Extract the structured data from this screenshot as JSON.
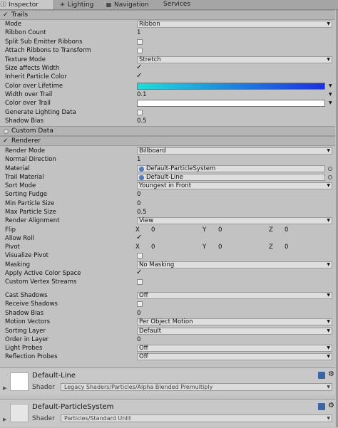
{
  "tabs": [
    {
      "icon": "info-icon",
      "glyph": "ⓘ",
      "label": "Inspector"
    },
    {
      "icon": "lighting-icon",
      "glyph": "☀",
      "label": "Lighting"
    },
    {
      "icon": "navigation-icon",
      "glyph": "▦",
      "label": "Navigation"
    },
    {
      "icon": "",
      "glyph": "",
      "label": "Services"
    }
  ],
  "trails": {
    "header": "Trails",
    "mode": {
      "label": "Mode",
      "value": "Ribbon"
    },
    "ribbon_count": {
      "label": "Ribbon Count",
      "value": "1"
    },
    "split_sub": {
      "label": "Split Sub Emitter Ribbons",
      "checked": false
    },
    "attach_ribbons": {
      "label": "Attach Ribbons to Transform",
      "checked": false
    },
    "texture_mode": {
      "label": "Texture Mode",
      "value": "Stretch"
    },
    "size_affects_width": {
      "label": "Size affects Width",
      "checked": true
    },
    "inherit_color": {
      "label": "Inherit Particle Color",
      "checked": true
    },
    "color_over_lifetime": {
      "label": "Color over Lifetime",
      "gradient_from": "#19e0dc",
      "gradient_to": "#1d2fe6"
    },
    "width_over_trail": {
      "label": "Width over Trail",
      "value": "0.1"
    },
    "color_over_trail": {
      "label": "Color over Trail",
      "color": "#ffffff"
    },
    "generate_lighting": {
      "label": "Generate Lighting Data",
      "checked": false
    },
    "shadow_bias": {
      "label": "Shadow Bias",
      "value": "0.5"
    }
  },
  "custom_data": {
    "header": "Custom Data"
  },
  "renderer": {
    "header": "Renderer",
    "render_mode": {
      "label": "Render Mode",
      "value": "Billboard"
    },
    "normal_direction": {
      "label": "Normal Direction",
      "value": "1"
    },
    "material": {
      "label": "Material",
      "value": "Default-ParticleSystem"
    },
    "trail_material": {
      "label": "Trail Material",
      "value": "Default-Line"
    },
    "sort_mode": {
      "label": "Sort Mode",
      "value": "Youngest in Front"
    },
    "sorting_fudge": {
      "label": "Sorting Fudge",
      "value": "0"
    },
    "min_particle_size": {
      "label": "Min Particle Size",
      "value": "0"
    },
    "max_particle_size": {
      "label": "Max Particle Size",
      "value": "0.5"
    },
    "render_alignment": {
      "label": "Render Alignment",
      "value": "View"
    },
    "flip": {
      "label": "Flip",
      "x_label": "X",
      "x": "0",
      "y_label": "Y",
      "y": "0",
      "z_label": "Z",
      "z": "0"
    },
    "allow_roll": {
      "label": "Allow Roll",
      "checked": true
    },
    "pivot": {
      "label": "Pivot",
      "x_label": "X",
      "x": "0",
      "y_label": "Y",
      "y": "0",
      "z_label": "Z",
      "z": "0"
    },
    "visualize_pivot": {
      "label": "Visualize Pivot",
      "checked": false
    },
    "masking": {
      "label": "Masking",
      "value": "No Masking"
    },
    "apply_active_color_space": {
      "label": "Apply Active Color Space",
      "checked": true
    },
    "custom_vertex_streams": {
      "label": "Custom Vertex Streams",
      "checked": false
    },
    "cast_shadows": {
      "label": "Cast Shadows",
      "value": "Off"
    },
    "receive_shadows": {
      "label": "Receive Shadows",
      "checked": false
    },
    "shadow_bias": {
      "label": "Shadow Bias",
      "value": "0"
    },
    "motion_vectors": {
      "label": "Motion Vectors",
      "value": "Per Object Motion"
    },
    "sorting_layer": {
      "label": "Sorting Layer",
      "value": "Default"
    },
    "order_in_layer": {
      "label": "Order in Layer",
      "value": "0"
    },
    "light_probes": {
      "label": "Light Probes",
      "value": "Off"
    },
    "reflection_probes": {
      "label": "Reflection Probes",
      "value": "Off"
    }
  },
  "materials": [
    {
      "name": "Default-Line",
      "shader_label": "Shader",
      "shader": "Legacy Shaders/Particles/Alpha Blended Premultiply"
    },
    {
      "name": "Default-ParticleSystem",
      "shader_label": "Shader",
      "shader": "Particles/Standard Unlit"
    }
  ]
}
